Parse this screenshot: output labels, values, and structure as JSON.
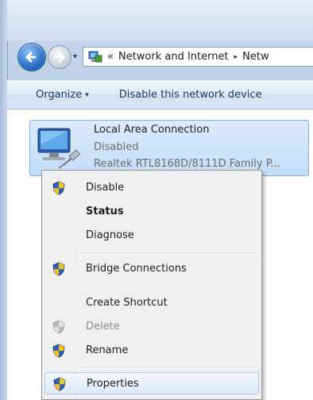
{
  "address_bar": {
    "overflow_chevron": "«",
    "crumbs": [
      "Network and Internet",
      "Netw"
    ],
    "separator": "▸",
    "history_dropdown": "▾"
  },
  "toolbar": {
    "organize_label": "Organize",
    "organize_arrow": "▾",
    "disable_label": "Disable this network device"
  },
  "connection": {
    "name": "Local Area Connection",
    "status": "Disabled",
    "device": "Realtek RTL8168D/8111D Family P..."
  },
  "context_menu": {
    "items": [
      {
        "label": "Disable",
        "icon": "uac-shield-icon",
        "bold": false,
        "disabled": false
      },
      {
        "label": "Status",
        "icon": "",
        "bold": true,
        "disabled": false
      },
      {
        "label": "Diagnose",
        "icon": "",
        "bold": false,
        "disabled": false
      },
      {
        "label": "Bridge Connections",
        "icon": "uac-shield-icon",
        "bold": false,
        "disabled": false
      },
      {
        "label": "Create Shortcut",
        "icon": "",
        "bold": false,
        "disabled": false
      },
      {
        "label": "Delete",
        "icon": "uac-shield-icon",
        "bold": false,
        "disabled": true
      },
      {
        "label": "Rename",
        "icon": "uac-shield-icon",
        "bold": false,
        "disabled": false
      },
      {
        "label": "Properties",
        "icon": "uac-shield-icon",
        "bold": false,
        "disabled": false,
        "highlighted": true
      }
    ]
  },
  "colors": {
    "toolbar_text": "#1e395b",
    "selection_fill": "#c2dcf7",
    "menu_background": "#f0f0f0",
    "disabled_text": "#8d8d8d"
  }
}
